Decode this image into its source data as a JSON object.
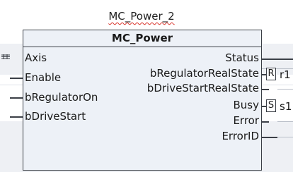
{
  "block": {
    "instance_name": "MC_Power_2",
    "type_name": "MC_Power"
  },
  "inputs": [
    {
      "name": "Axis",
      "connector": "reference-icon"
    },
    {
      "name": "Enable"
    },
    {
      "name": "bRegulatorOn"
    },
    {
      "name": "bDriveStart"
    }
  ],
  "outputs": [
    {
      "name": "Status"
    },
    {
      "name": "bRegulatorRealState",
      "flag": "R",
      "variable": "r1"
    },
    {
      "name": "bDriveStartRealState"
    },
    {
      "name": "Busy",
      "flag": "S",
      "variable": "s1"
    },
    {
      "name": "Error"
    },
    {
      "name": "ErrorID"
    }
  ]
}
